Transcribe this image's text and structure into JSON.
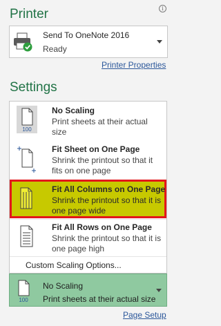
{
  "printer": {
    "heading": "Printer",
    "info_glyph": "i",
    "name": "Send To OneNote 2016",
    "status": "Ready",
    "properties_link": "Printer Properties"
  },
  "settings": {
    "heading": "Settings",
    "menu": {
      "items": [
        {
          "title": "No Scaling",
          "description": "Print sheets at their actual size",
          "icon": "no-scaling-icon",
          "badge": "100"
        },
        {
          "title": "Fit Sheet on One Page",
          "description": "Shrink the printout so that it fits on one page",
          "icon": "fit-sheet-icon"
        },
        {
          "title": "Fit All Columns on One Page",
          "description": "Shrink the printout so that it is one page wide",
          "icon": "fit-columns-icon",
          "selected": true
        },
        {
          "title": "Fit All Rows on One Page",
          "description": "Shrink the printout so that it is one page high",
          "icon": "fit-rows-icon"
        }
      ],
      "custom_option": "Custom Scaling Options..."
    },
    "current": {
      "title": "No Scaling",
      "description": "Print sheets at their actual size",
      "badge": "100"
    },
    "page_setup_link": "Page Setup"
  },
  "colors": {
    "accent": "#217346",
    "selected_bg": "#c7c900",
    "selected_border": "#e3161b",
    "current_bg": "#8fc9a0",
    "link": "#2b579a"
  }
}
